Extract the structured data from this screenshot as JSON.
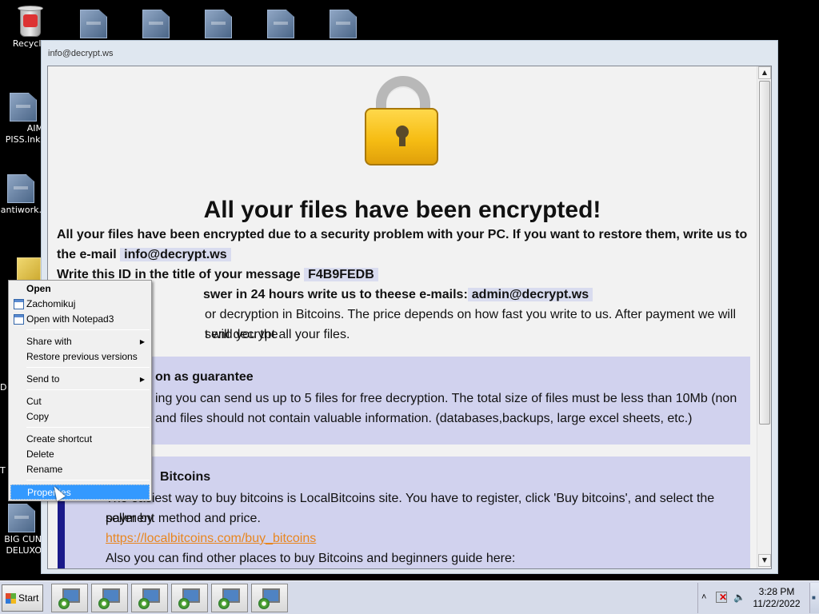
{
  "desktop": {
    "icons": [
      {
        "label": "Recycle",
        "icon": "recycle-bin-icon"
      },
      {
        "label": "AIM",
        "icon": "file-icon"
      },
      {
        "label": "PISS.lnk.",
        "icon": "file-icon"
      },
      {
        "label": "antiwork.",
        "icon": "file-icon"
      },
      {
        "label": "D",
        "icon": "file-icon"
      },
      {
        "label": "T",
        "icon": "file-icon"
      },
      {
        "label": "BIG CUN",
        "icon": "file-icon"
      },
      {
        "label": "DELUXO",
        "icon": "file-icon"
      }
    ]
  },
  "window": {
    "title": "info@decrypt.ws",
    "headline": "All your files have been encrypted!",
    "para1_text": "All your files have been encrypted due to a security problem with your PC. If you want to restore them, write us to the e-mail",
    "email": "info@decrypt.ws",
    "id_prefix": "Write this ID in the title of your message",
    "id_value": "F4B9FEDB",
    "answer_prefix": "swer in 24 hours write us to theese e-mails:",
    "admin_email": "admin@decrypt.ws",
    "para_pay_1": "or decryption in Bitcoins. The price depends on how fast you write to us. After payment we will send you the",
    "para_pay_2": "t will decrypt all your files.",
    "guarantee": {
      "title": "on as guarantee",
      "line1": "ing you can send us up to 5 files for free decryption. The total size of files must be less than 10Mb (non",
      "line2": "and files should not contain valuable information. (databases,backups, large excel sheets, etc.)"
    },
    "bitcoins": {
      "title": "Bitcoins",
      "line1": "The easiest way to buy bitcoins is LocalBitcoins site. You have to register, click 'Buy bitcoins', and select the seller by",
      "line2": "payment method and price.",
      "link": "https://localbitcoins.com/buy_bitcoins",
      "line3": "Also you can find other places to buy Bitcoins and beginners guide here:"
    }
  },
  "context_menu": {
    "open": "Open",
    "zachomikuj": "Zachomikuj",
    "open_notepad": "Open with Notepad3",
    "share_with": "Share with",
    "restore_prev": "Restore previous versions",
    "send_to": "Send to",
    "cut": "Cut",
    "copy": "Copy",
    "create_shortcut": "Create shortcut",
    "delete": "Delete",
    "rename": "Rename",
    "properties": "Properties"
  },
  "taskbar": {
    "start_label": "Start",
    "time": "3:28 PM",
    "date": "11/22/2022"
  },
  "colors": {
    "highlight": "#d9dcef",
    "guarantee_box": "#d1d2ee",
    "box_bar": "#1a1a8a",
    "link": "#e8861f",
    "menu_selection": "#3399ff"
  }
}
